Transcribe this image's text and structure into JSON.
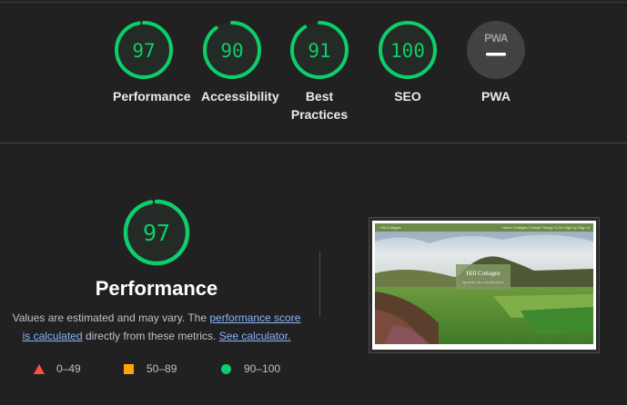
{
  "colors": {
    "background": "#212121",
    "pass": "#0cce6b",
    "average": "#ffa400",
    "fail": "#ff4e42",
    "link": "#8ab4f8",
    "pwa_bg": "#424242"
  },
  "categories": [
    {
      "label": "Performance",
      "score": "97",
      "fraction": 0.97
    },
    {
      "label": "Accessibility",
      "score": "90",
      "fraction": 0.9
    },
    {
      "label": "Best Practices",
      "score": "91",
      "fraction": 0.91
    },
    {
      "label": "SEO",
      "score": "100",
      "fraction": 1.0
    },
    {
      "label": "PWA",
      "badge_text": "PWA",
      "status": "not-applicable"
    }
  ],
  "main": {
    "score": "97",
    "fraction": 0.97,
    "title": "Performance",
    "desc_part1": "Values are estimated and may vary. The ",
    "link1": "performance score is calculated",
    "desc_part2": " directly from these metrics. ",
    "link2": "See calculator."
  },
  "legend": [
    {
      "range": "0–49",
      "shape": "triangle",
      "color": "#ff4e42"
    },
    {
      "range": "50–89",
      "shape": "square",
      "color": "#ffa400"
    },
    {
      "range": "90–100",
      "shape": "circle",
      "color": "#0cce6b"
    }
  ],
  "screenshot": {
    "brand": "Hill Cottages",
    "nav_links": "Home  Cottages  Contact  Things To Do  Sign Up  Sign In",
    "title": "Hill Cottages",
    "subtitle": "Your Perfect Stay in the Peak District"
  }
}
